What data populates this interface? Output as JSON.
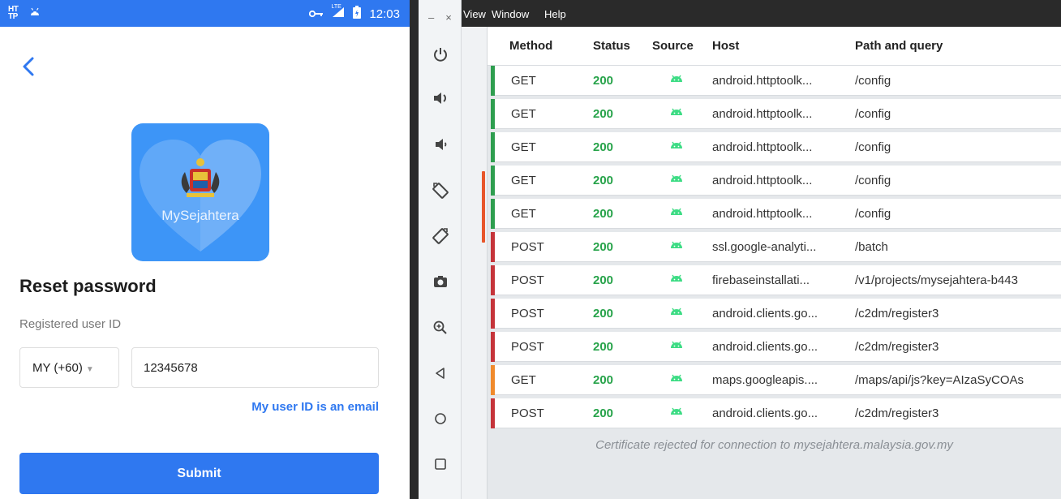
{
  "phone": {
    "status_bar": {
      "ht_label": "HT\nTP",
      "time": "12:03",
      "network": "LTE"
    },
    "logo_text": "MySejahtera",
    "title": "Reset password",
    "user_id_label": "Registered user ID",
    "country_code": "MY (+60)",
    "user_id_value": "12345678",
    "email_link": "My user ID is an email",
    "submit_label": "Submit"
  },
  "emulator_toolbar": {
    "window_controls": [
      "–",
      "×"
    ],
    "buttons": [
      "power-icon",
      "volume-up-icon",
      "volume-down-icon",
      "rotate-left-icon",
      "rotate-right-icon",
      "camera-icon",
      "zoom-icon",
      "back-icon",
      "home-icon",
      "overview-icon"
    ]
  },
  "menubar": {
    "items": [
      "View",
      "Window",
      "Help"
    ]
  },
  "table": {
    "columns": [
      "Method",
      "Status",
      "Source",
      "Host",
      "Path and query"
    ],
    "rows": [
      {
        "method": "GET",
        "status": "200",
        "host": "android.httptoolk...",
        "path": "/config",
        "marker": "#2e9e4f"
      },
      {
        "method": "GET",
        "status": "200",
        "host": "android.httptoolk...",
        "path": "/config",
        "marker": "#2e9e4f"
      },
      {
        "method": "GET",
        "status": "200",
        "host": "android.httptoolk...",
        "path": "/config",
        "marker": "#2e9e4f"
      },
      {
        "method": "GET",
        "status": "200",
        "host": "android.httptoolk...",
        "path": "/config",
        "marker": "#2e9e4f"
      },
      {
        "method": "GET",
        "status": "200",
        "host": "android.httptoolk...",
        "path": "/config",
        "marker": "#2e9e4f"
      },
      {
        "method": "POST",
        "status": "200",
        "host": "ssl.google-analyti...",
        "path": "/batch",
        "marker": "#c5343a"
      },
      {
        "method": "POST",
        "status": "200",
        "host": "firebaseinstallati...",
        "path": "/v1/projects/mysejahtera-b443",
        "marker": "#c5343a"
      },
      {
        "method": "POST",
        "status": "200",
        "host": "android.clients.go...",
        "path": "/c2dm/register3",
        "marker": "#c5343a"
      },
      {
        "method": "POST",
        "status": "200",
        "host": "android.clients.go...",
        "path": "/c2dm/register3",
        "marker": "#c5343a"
      },
      {
        "method": "GET",
        "status": "200",
        "host": "maps.googleapis....",
        "path": "/maps/api/js?key=AIzaSyCOAs",
        "marker": "#f08a2c"
      },
      {
        "method": "POST",
        "status": "200",
        "host": "android.clients.go...",
        "path": "/c2dm/register3",
        "marker": "#c5343a"
      }
    ],
    "rejected_notice": "Certificate rejected for connection to mysejahtera.malaysia.gov.my"
  },
  "colors": {
    "accent": "#2f78f0",
    "status_ok": "#27a34a",
    "android_source": "#3ddc84"
  }
}
